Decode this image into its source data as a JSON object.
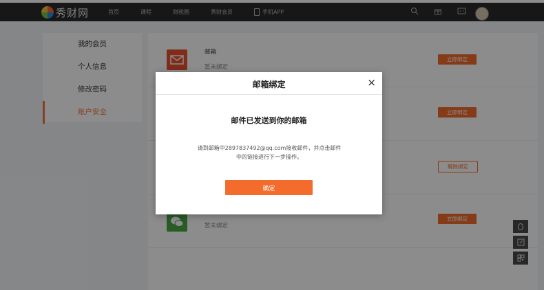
{
  "header": {
    "logo_text": "秀财网",
    "nav": [
      {
        "label": "首页"
      },
      {
        "label": "课程"
      },
      {
        "label": "财税圈"
      },
      {
        "label": "秀财会员"
      },
      {
        "label": "手机APP"
      }
    ],
    "icons": [
      "search-icon",
      "gift-icon",
      "message-icon",
      "avatar"
    ]
  },
  "sidebar": {
    "items": [
      {
        "label": "我的会员"
      },
      {
        "label": "个人信息"
      },
      {
        "label": "修改密码"
      },
      {
        "label": "账户安全"
      }
    ],
    "active_index": 3
  },
  "rows": [
    {
      "title": "邮箱",
      "status": "暂未绑定",
      "button": "立即绑定",
      "icon": "mail-icon",
      "color": "#e8502f"
    },
    {
      "title": "",
      "status": "",
      "button": "立即绑定",
      "icon": "",
      "color": ""
    },
    {
      "title": "",
      "status": "",
      "button": "解除绑定",
      "icon": "",
      "color": ""
    },
    {
      "title": "",
      "status": "暂未绑定",
      "button": "立即绑定",
      "icon": "wechat-icon",
      "color": "#48a843"
    }
  ],
  "modal": {
    "title": "邮箱绑定",
    "close": "×",
    "heading": "邮件已发送到你的邮箱",
    "description": "请到邮箱中2897837492@qq.com接收邮件，并点击邮件中的链接进行下一步操作。",
    "confirm": "确定"
  },
  "tools": [
    "qq-icon",
    "edit-icon",
    "qrcode-icon"
  ],
  "colors": {
    "accent": "#f36c2b",
    "header_bg": "#2b2b2b"
  }
}
